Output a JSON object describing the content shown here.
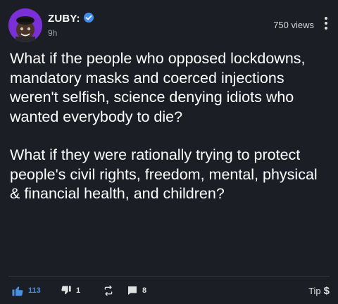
{
  "post": {
    "author": "ZUBY:",
    "time": "9h",
    "views": "750 views",
    "paragraphs": [
      "What if the people who opposed lockdowns, mandatory masks and coerced injections weren't selfish, science denying idiots who wanted everybody to die?",
      "What if they were rationally trying to protect people's civil rights, freedom, mental, physical & financial health, and children?"
    ]
  },
  "actions": {
    "likes": "113",
    "dislikes": "1",
    "comments": "8",
    "tip_label": "Tip",
    "tip_symbol": "$"
  },
  "colors": {
    "background": "#1c1e26",
    "accent": "#4a90e2",
    "verified": "#3d8ef0"
  },
  "icons": [
    "verified-badge-icon",
    "more-vertical-icon",
    "thumbs-up-icon",
    "thumbs-down-icon",
    "repost-icon",
    "comment-icon"
  ]
}
